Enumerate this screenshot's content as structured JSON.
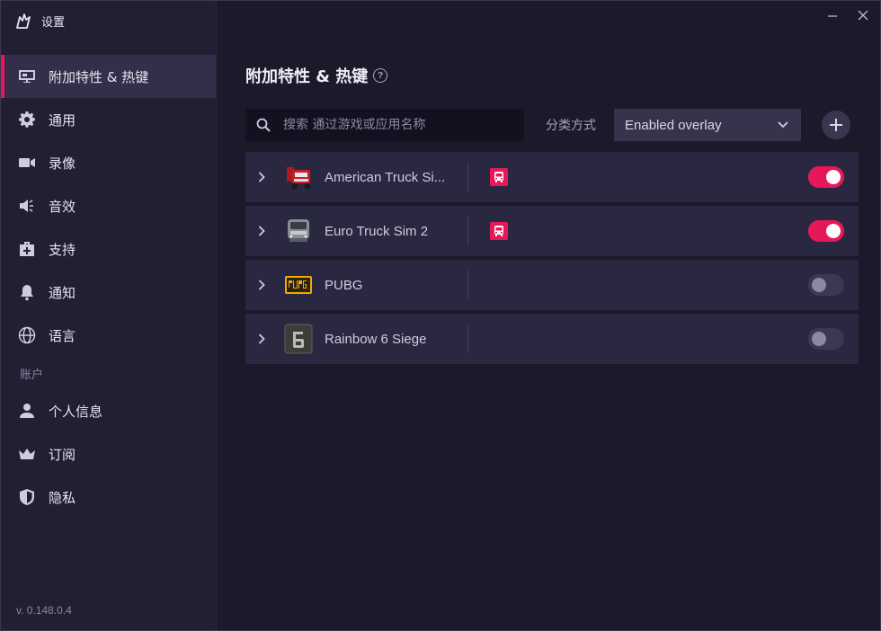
{
  "window": {
    "title": "设置",
    "minimize_icon": "minimize-icon",
    "close_icon": "close-icon"
  },
  "sidebar": {
    "items": [
      {
        "label": "附加特性 & 热键",
        "icon": "overlay-icon",
        "active": true
      },
      {
        "label": "通用",
        "icon": "gear-icon"
      },
      {
        "label": "录像",
        "icon": "video-camera-icon"
      },
      {
        "label": "音效",
        "icon": "speaker-icon"
      },
      {
        "label": "支持",
        "icon": "medkit-icon"
      },
      {
        "label": "通知",
        "icon": "bell-icon"
      },
      {
        "label": "语言",
        "icon": "globe-icon"
      }
    ],
    "account_section": "账户",
    "account_items": [
      {
        "label": "个人信息",
        "icon": "user-icon"
      },
      {
        "label": "订阅",
        "icon": "crown-icon"
      },
      {
        "label": "隐私",
        "icon": "shield-icon"
      }
    ],
    "version": "v. 0.148.0.4"
  },
  "main": {
    "title": "附加特性 & 热键",
    "search_placeholder": "搜索 通过游戏或应用名称",
    "sort_label": "分类方式",
    "sort_value": "Enabled overlay",
    "games": [
      {
        "name": "American Truck Si...",
        "icon": "american-truck-icon",
        "badge": true,
        "enabled": true
      },
      {
        "name": "Euro Truck Sim 2",
        "icon": "euro-truck-icon",
        "badge": true,
        "enabled": true
      },
      {
        "name": "PUBG",
        "icon": "pubg-icon",
        "badge": false,
        "enabled": false
      },
      {
        "name": "Rainbow 6 Siege",
        "icon": "rainbow-six-icon",
        "badge": false,
        "enabled": false
      }
    ]
  },
  "colors": {
    "accent": "#e6185a",
    "sidebar_bg": "#221f33",
    "main_bg": "#1b1a2a",
    "row_bg": "#2a2740"
  }
}
